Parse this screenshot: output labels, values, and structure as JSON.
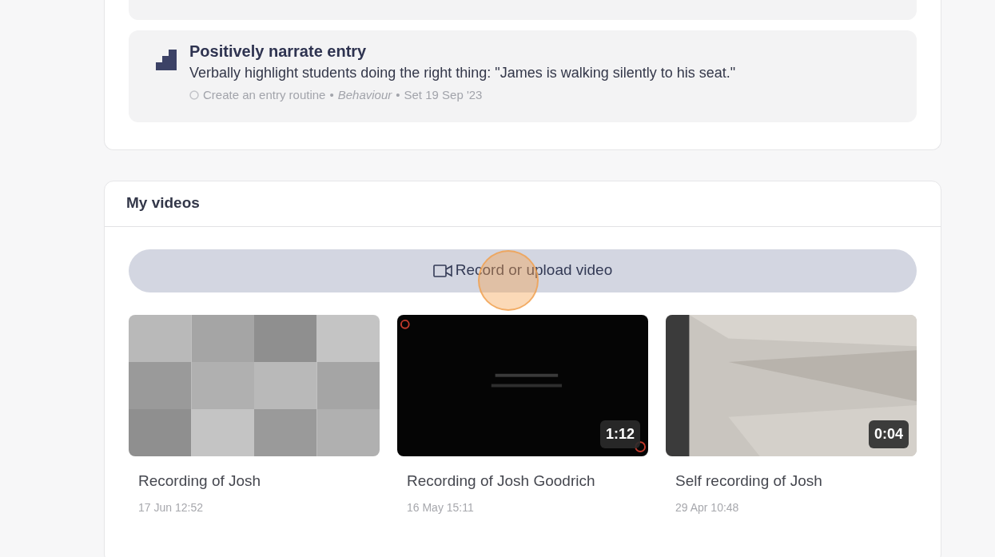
{
  "plan_item": {
    "title": "Positively narrate entry",
    "description": "Verbally highlight students doing the right thing: \"James is walking silently to his seat.\"",
    "separator": "•",
    "meta": [
      {
        "text": "Create an entry routine",
        "italic": false
      },
      {
        "text": "Behaviour",
        "italic": true
      },
      {
        "text": "Set 19 Sep '23",
        "italic": false
      }
    ]
  },
  "videos_panel": {
    "title": "My videos",
    "record_button": "Record or upload video",
    "videos": [
      {
        "title": "Recording of Josh",
        "date": "17 Jun 12:52"
      },
      {
        "title": "Recording of Josh Goodrich",
        "date": "16 May 15:11",
        "duration": "1:12"
      },
      {
        "title": "Self recording of Josh",
        "date": "29 Apr 10:48",
        "duration": "0:04"
      }
    ]
  }
}
